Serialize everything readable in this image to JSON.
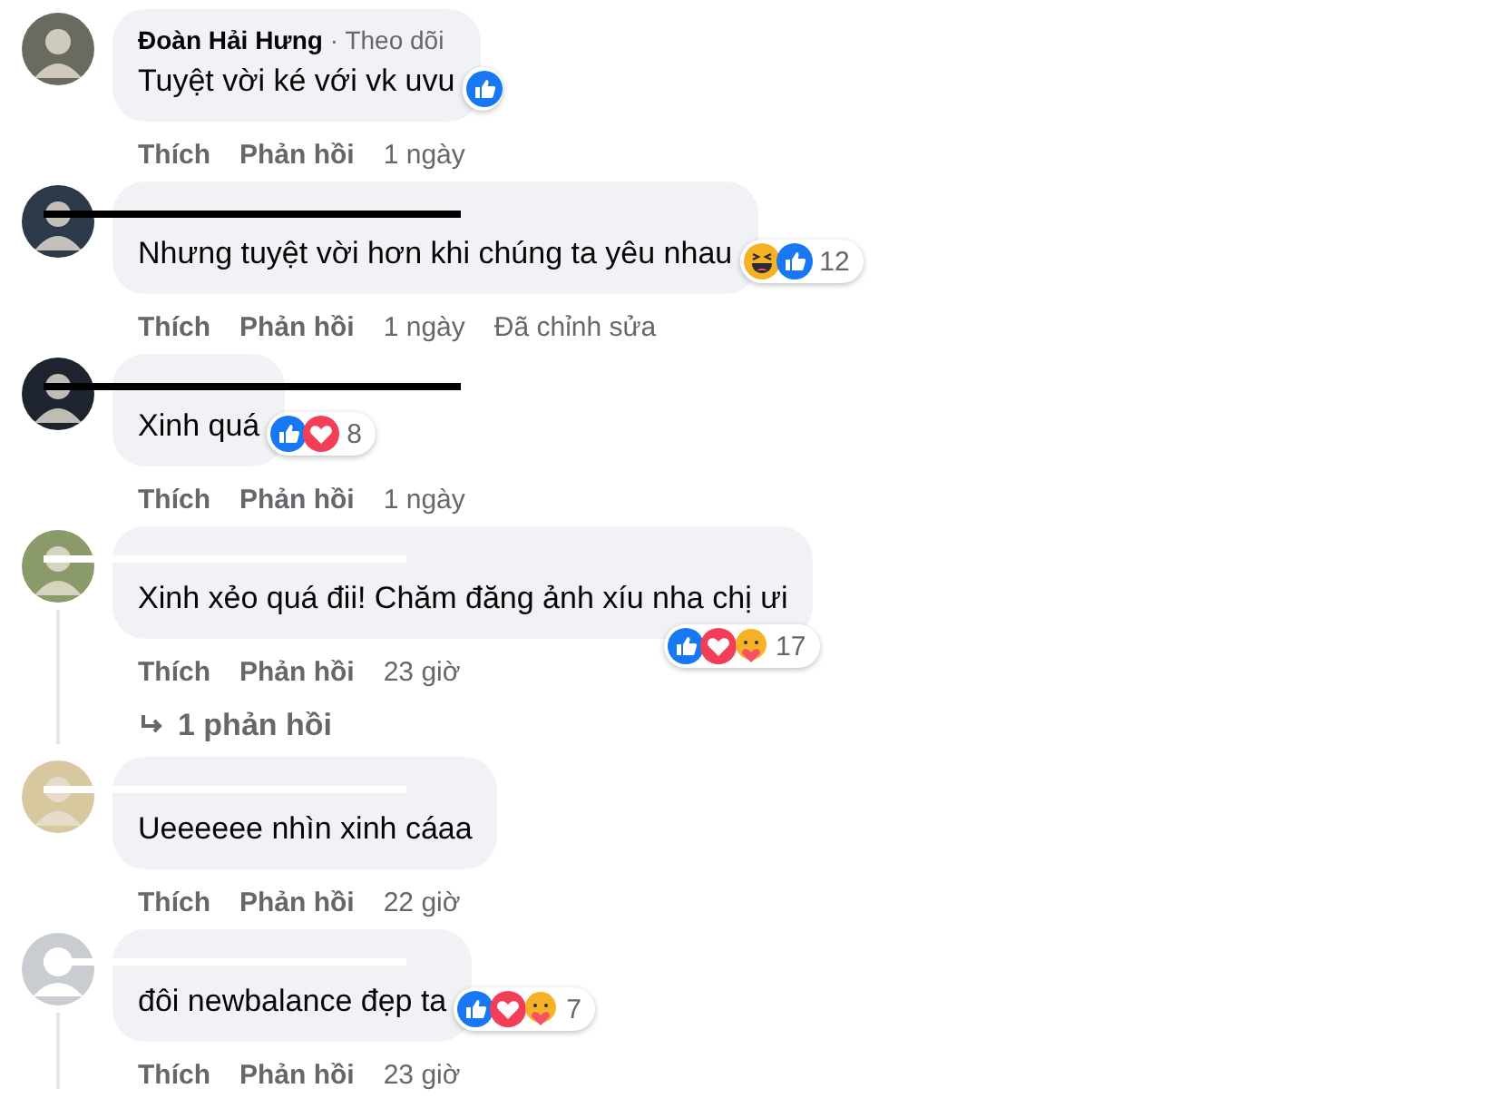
{
  "comments": [
    {
      "avatar": {
        "kind": "photo"
      },
      "author": "Đoàn Hải Hưng",
      "follow": "· Theo dõi",
      "text": "Tuyệt vời ké với vk uvu",
      "reactions": [
        {
          "kind": "like"
        }
      ],
      "badge_below": false,
      "actions": [
        "Thích",
        "Phản hồi"
      ],
      "time": "1 ngày"
    },
    {
      "avatar": {
        "kind": "photo"
      },
      "redaction": {
        "kind": "black"
      },
      "text": "Nhưng tuyệt vời hơn khi chúng ta yêu nhau",
      "reactions": [
        {
          "kind": "haha"
        },
        {
          "kind": "like"
        }
      ],
      "count": "12",
      "badge_below": false,
      "actions": [
        "Thích",
        "Phản hồi"
      ],
      "time": "1 ngày",
      "edited": "Đã chỉnh sửa"
    },
    {
      "avatar": {
        "kind": "photo"
      },
      "redaction": {
        "kind": "black"
      },
      "text": "Xinh quá",
      "reactions": [
        {
          "kind": "like"
        },
        {
          "kind": "love"
        }
      ],
      "count": "8",
      "badge_below": false,
      "actions": [
        "Thích",
        "Phản hồi"
      ],
      "time": "1 ngày"
    },
    {
      "avatar": {
        "kind": "photo"
      },
      "redaction": {
        "kind": "white"
      },
      "text": "Xinh xẻo quá đii! Chăm đăng ảnh xíu nha chị ưi",
      "reactions": [
        {
          "kind": "like"
        },
        {
          "kind": "love"
        },
        {
          "kind": "care"
        }
      ],
      "count": "17",
      "badge_below": true,
      "actions": [
        "Thích",
        "Phản hồi"
      ],
      "time": "23 giờ",
      "replies": "1 phản hồi"
    },
    {
      "avatar": {
        "kind": "photo"
      },
      "redaction": {
        "kind": "white"
      },
      "text": "Ueeeeee nhìn xinh cáaa",
      "actions": [
        "Thích",
        "Phản hồi"
      ],
      "time": "22 giờ"
    },
    {
      "avatar": {
        "kind": "default"
      },
      "redaction": {
        "kind": "white"
      },
      "text": "đôi newbalance đẹp ta",
      "reactions": [
        {
          "kind": "like"
        },
        {
          "kind": "love"
        },
        {
          "kind": "care"
        }
      ],
      "count": "7",
      "badge_below": false,
      "actions": [
        "Thích",
        "Phản hồi"
      ],
      "time": "23 giờ",
      "thread": true
    }
  ]
}
